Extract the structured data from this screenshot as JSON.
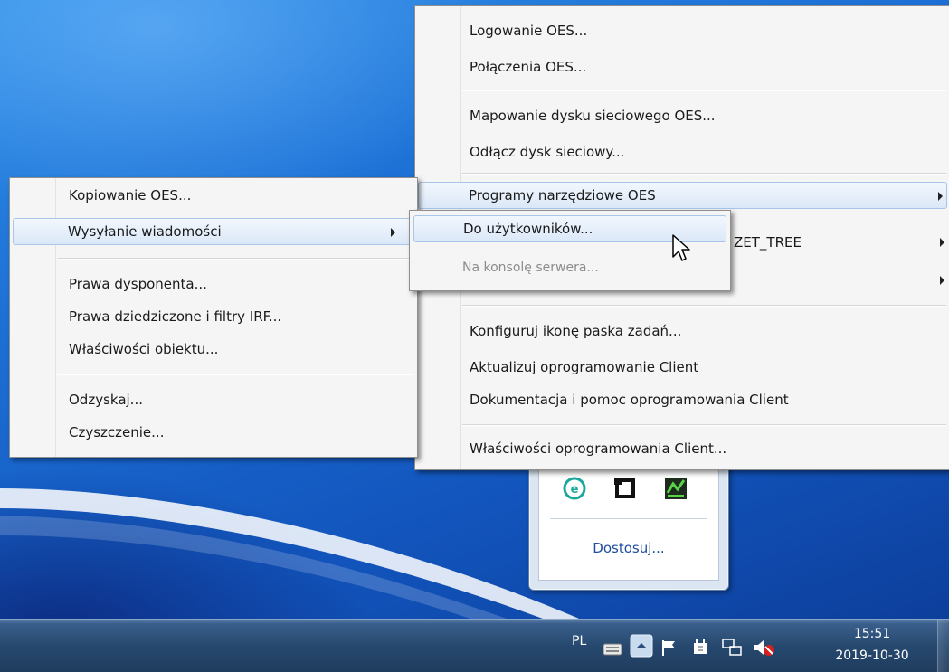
{
  "main_menu": {
    "items": [
      {
        "label": "Logowanie OES..."
      },
      {
        "label": "Połączenia OES..."
      },
      {
        "label": "Mapowanie dysku sieciowego OES..."
      },
      {
        "label": "Odłącz dysk sieciowy..."
      },
      {
        "label": "Programy narzędziowe OES",
        "submenu": true
      },
      {
        "label": "ZET_TREE",
        "submenu": true
      },
      {
        "label": "",
        "submenu": true
      },
      {
        "label": "Konfiguruj ikonę paska zadań..."
      },
      {
        "label": "Aktualizuj oprogramowanie Client"
      },
      {
        "label": "Dokumentacja i pomoc oprogramowania Client"
      },
      {
        "label": "Właściwości oprogramowania Client..."
      }
    ]
  },
  "oes_submenu": {
    "items": [
      {
        "label": "Kopiowanie OES..."
      },
      {
        "label": "Wysyłanie wiadomości",
        "submenu": true
      },
      {
        "label": "Prawa dysponenta..."
      },
      {
        "label": "Prawa dziedziczone i filtry IRF..."
      },
      {
        "label": "Właściwości obiektu..."
      },
      {
        "label": "Odzyskaj..."
      },
      {
        "label": "Czyszczenie..."
      }
    ]
  },
  "message_submenu": {
    "items": [
      {
        "label": "Do użytkowników..."
      },
      {
        "label": "Na konsolę serwera...",
        "disabled": true
      }
    ]
  },
  "tray_popup": {
    "icons": [
      "eset-icon",
      "square-app-icon",
      "green-app-icon"
    ],
    "customize_label": "Dostosuj..."
  },
  "taskbar": {
    "language": "PL",
    "tray_icons": [
      "keyboard-icon",
      "show-hidden-icons-icon",
      "action-center-flag-icon",
      "power-icon",
      "network-icon",
      "volume-muted-icon"
    ],
    "time": "15:51",
    "date": "2019-10-30"
  },
  "colors": {
    "menu_bg": "#f5f5f5",
    "highlight_border": "#a7c6ea",
    "taskbar": "#27496f",
    "desktop": "#1c6fd5"
  }
}
